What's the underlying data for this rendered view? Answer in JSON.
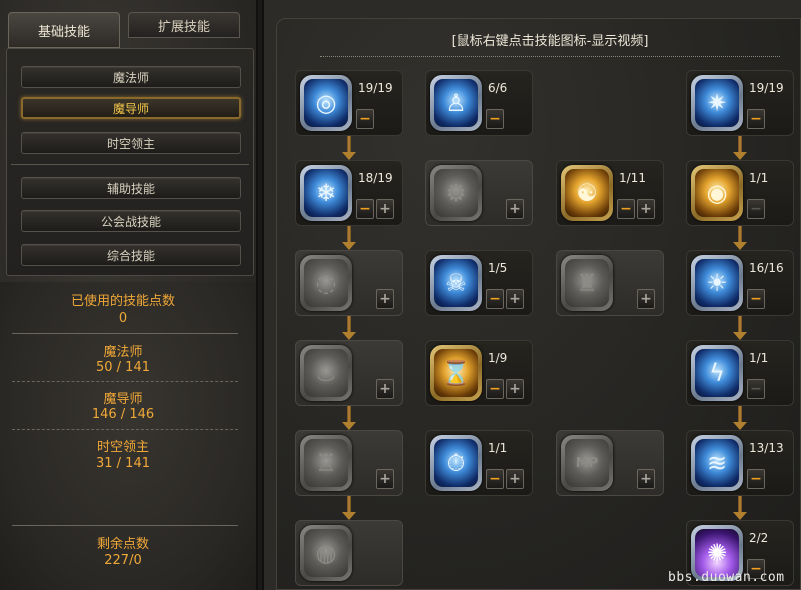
{
  "tabs": {
    "basic": "基础技能",
    "extended": "扩展技能"
  },
  "classes": {
    "mage": "魔法师",
    "magister": "魔导师",
    "chronomancer": "时空领主",
    "support": "辅助技能",
    "guild": "公会战技能",
    "general": "综合技能"
  },
  "stats": {
    "used_label": "已使用的技能点数",
    "used_value": "0",
    "mage_label": "魔法师",
    "mage_value": "50 / 141",
    "magister_label": "魔导师",
    "magister_value": "146 / 146",
    "chrono_label": "时空领主",
    "chrono_value": "31 / 141",
    "remaining_label": "剩余点数",
    "remaining_value": "227/0"
  },
  "tree": {
    "title": "[鼠标右键点击技能图标-显示视频]",
    "minus_symbol": "−",
    "plus_symbol": "+",
    "skills": [
      {
        "level": "19/19",
        "icon": "blue-orb-icon",
        "glyph": "◎"
      },
      {
        "level": "6/6",
        "icon": "blue-figure-icon",
        "glyph": "♙"
      },
      {
        "level": "19/19",
        "icon": "blue-star-icon",
        "glyph": "✷"
      },
      {
        "level": "18/19",
        "icon": "blue-snowflakes-icon",
        "glyph": "❄"
      },
      {
        "level": "",
        "icon": "locked-gear-icon",
        "glyph": "⚙"
      },
      {
        "level": "1/11",
        "icon": "gold-vortex-icon",
        "glyph": "☯"
      },
      {
        "level": "1/1",
        "icon": "gold-clock-icon",
        "glyph": "◉"
      },
      {
        "level": "",
        "icon": "locked-swirl-icon",
        "glyph": "◌"
      },
      {
        "level": "1/5",
        "icon": "blue-skull-icon",
        "glyph": "☠"
      },
      {
        "level": "",
        "icon": "locked-hood-icon",
        "glyph": "♜"
      },
      {
        "level": "16/16",
        "icon": "blue-rays-icon",
        "glyph": "☀"
      },
      {
        "level": "",
        "icon": "locked-flame-icon",
        "glyph": "♨"
      },
      {
        "level": "1/9",
        "icon": "gold-hourglass-icon",
        "glyph": "⌛"
      },
      {
        "level": "1/1",
        "icon": "blue-lightning-icon",
        "glyph": "ϟ"
      },
      {
        "level": "",
        "icon": "locked-golem-icon",
        "glyph": "♖"
      },
      {
        "level": "1/1",
        "icon": "blue-stopwatch-icon",
        "glyph": "⏱"
      },
      {
        "level": "",
        "icon": "locked-mp-icon",
        "glyph": "MP"
      },
      {
        "level": "13/13",
        "icon": "blue-tornado-icon",
        "glyph": "≋"
      },
      {
        "level": "",
        "icon": "locked-portal-icon",
        "glyph": "◍"
      },
      {
        "level": "2/2",
        "icon": "purple-burst-icon",
        "glyph": "✺"
      }
    ]
  },
  "watermark": "bbs.duowan.com"
}
